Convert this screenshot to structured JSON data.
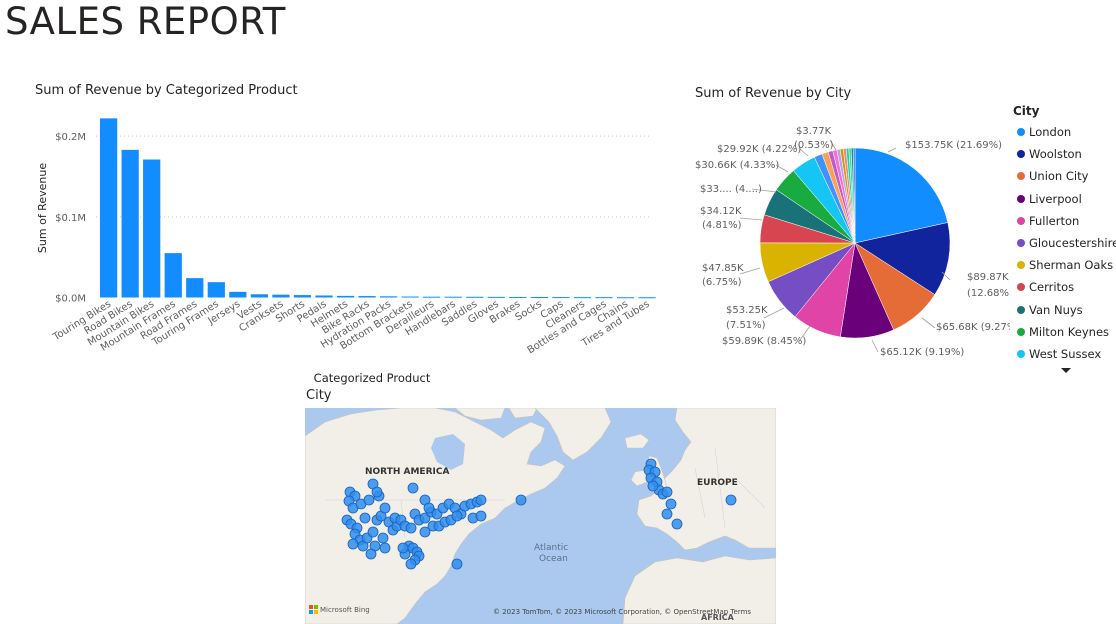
{
  "report_title": "SALES REPORT",
  "bar_chart": {
    "title": "Sum of Revenue by Categorized Product",
    "xlabel": "Categorized Product",
    "ylabel": "Sum of Revenue",
    "tick_labels": [
      "$0.0M",
      "$0.1M",
      "$0.2M"
    ],
    "bar_color": "#118DFF"
  },
  "pie_chart": {
    "title": "Sum of Revenue by City",
    "legend_title": "City",
    "slice_labels": [
      "$153.75K (21.69%)",
      "$89.87K",
      "(12.68%)",
      "$65.68K (9.27%)",
      "$65.12K (9.19%)",
      "$59.89K (8.45%)",
      "$53.25K",
      "(7.51%)",
      "$47.85K",
      "(6.75%)",
      "$34.12K",
      "(4.81%)",
      "$33.... (4....)",
      "$30.66K (4.33%)",
      "$29.92K (4.22%)",
      "$3.77K",
      "(0.53%)"
    ]
  },
  "map": {
    "title": "City",
    "labels": {
      "north_america": "NORTH AMERICA",
      "europe": "EUROPE",
      "ocean_line1": "Atlantic",
      "ocean_line2": "Ocean",
      "africa": "AFRICA"
    },
    "provider": "Microsoft Bing",
    "copyright": "© 2023 TomTom, © 2023 Microsoft Corporation, © OpenStreetMap Terms",
    "colors": {
      "water": "#abc9ef",
      "land": "#f2efe9",
      "bubble": "#2f8ef0"
    }
  },
  "chart_data": [
    {
      "type": "bar",
      "title": "Sum of Revenue by Categorized Product",
      "xlabel": "Categorized Product",
      "ylabel": "Sum of Revenue",
      "ylim": [
        0,
        0.22
      ],
      "y_unit": "$M",
      "grid": true,
      "categories": [
        "Touring Bikes",
        "Road Bikes",
        "Mountain Bikes",
        "Mountain Frames",
        "Road Frames",
        "Touring Frames",
        "Jerseys",
        "Vests",
        "Cranksets",
        "Shorts",
        "Pedals",
        "Helmets",
        "Bike Racks",
        "Hydration Packs",
        "Bottom Brackets",
        "Derailleurs",
        "Handlebars",
        "Saddles",
        "Gloves",
        "Brakes",
        "Socks",
        "Caps",
        "Cleaners",
        "Bottles and Cages",
        "Chains",
        "Tires and Tubes"
      ],
      "values": [
        0.222,
        0.183,
        0.171,
        0.055,
        0.024,
        0.019,
        0.007,
        0.004,
        0.0035,
        0.003,
        0.0025,
        0.002,
        0.0018,
        0.0015,
        0.0012,
        0.001,
        0.001,
        0.0009,
        0.0008,
        0.0007,
        0.0006,
        0.0005,
        0.0004,
        0.0004,
        0.0003,
        0.0003
      ]
    },
    {
      "type": "pie",
      "title": "Sum of Revenue by City",
      "legend_title": "City",
      "legend_position": "right",
      "series": [
        {
          "name": "London",
          "value": 153.75,
          "percent": 21.69,
          "color": "#118DFF"
        },
        {
          "name": "Woolston",
          "value": 89.87,
          "percent": 12.68,
          "color": "#12239E"
        },
        {
          "name": "Union City",
          "value": 65.68,
          "percent": 9.27,
          "color": "#E66C37"
        },
        {
          "name": "Liverpool",
          "value": 65.12,
          "percent": 9.19,
          "color": "#6B007B"
        },
        {
          "name": "Fullerton",
          "value": 59.89,
          "percent": 8.45,
          "color": "#E044A7"
        },
        {
          "name": "Gloucestershire",
          "value": 53.25,
          "percent": 7.51,
          "color": "#744EC2"
        },
        {
          "name": "Sherman Oaks",
          "value": 47.85,
          "percent": 6.75,
          "color": "#D9B300"
        },
        {
          "name": "Cerritos",
          "value": 34.12,
          "percent": 4.81,
          "color": "#D64550"
        },
        {
          "name": "Van Nuys",
          "value": 33.0,
          "percent": 4.7,
          "color": "#197278"
        },
        {
          "name": "Milton Keynes",
          "value": 30.66,
          "percent": 4.33,
          "color": "#1AAB40"
        },
        {
          "name": "West Sussex",
          "value": 29.92,
          "percent": 4.22,
          "color": "#15C6F4"
        },
        {
          "value": 10.0,
          "percent": 1.4,
          "color": "#4092FF"
        },
        {
          "value": 8.0,
          "percent": 1.1,
          "color": "#FFA058"
        },
        {
          "value": 6.0,
          "percent": 0.8,
          "color": "#BE5DC9"
        },
        {
          "value": 5.0,
          "percent": 0.7,
          "color": "#F472D0"
        },
        {
          "value": 4.0,
          "percent": 0.56,
          "color": "#B5A1FF"
        },
        {
          "value": 3.77,
          "percent": 0.53,
          "color": "#C4A200"
        },
        {
          "value": 3.5,
          "percent": 0.5,
          "color": "#FF8080"
        },
        {
          "value": 3.2,
          "percent": 0.45,
          "color": "#00DBBC"
        },
        {
          "value": 3.0,
          "percent": 0.4,
          "color": "#5BD667"
        },
        {
          "value": 2.5,
          "percent": 0.35,
          "color": "#0091D5"
        },
        {
          "value": 2.0,
          "percent": 0.3,
          "color": "#4668C5"
        }
      ]
    }
  ]
}
